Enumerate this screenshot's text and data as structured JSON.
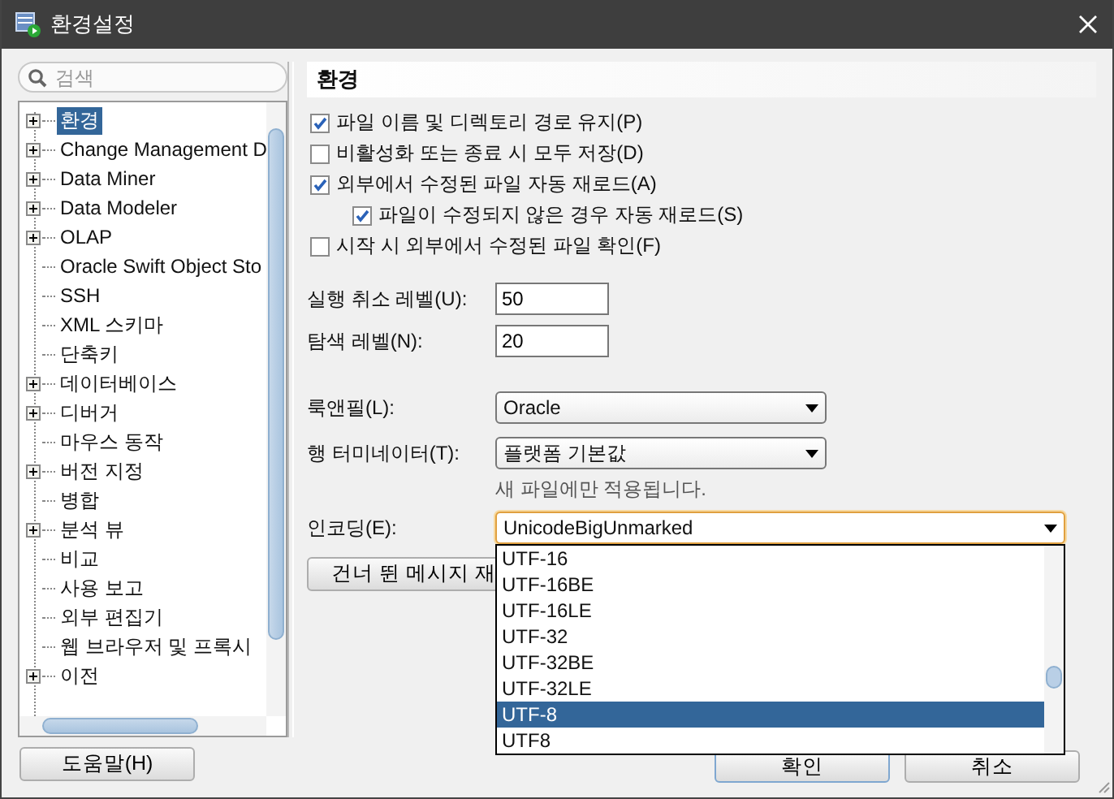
{
  "window": {
    "title": "환경설정"
  },
  "search": {
    "placeholder": "검색"
  },
  "tree": {
    "items": [
      {
        "label": "환경",
        "has_children": true,
        "selected": true
      },
      {
        "label": "Change Management D",
        "has_children": true,
        "selected": false
      },
      {
        "label": "Data Miner",
        "has_children": true,
        "selected": false
      },
      {
        "label": "Data Modeler",
        "has_children": true,
        "selected": false
      },
      {
        "label": "OLAP",
        "has_children": true,
        "selected": false
      },
      {
        "label": "Oracle Swift Object Sto",
        "has_children": false,
        "selected": false
      },
      {
        "label": "SSH",
        "has_children": false,
        "selected": false
      },
      {
        "label": "XML 스키마",
        "has_children": false,
        "selected": false
      },
      {
        "label": "단축키",
        "has_children": false,
        "selected": false
      },
      {
        "label": "데이터베이스",
        "has_children": true,
        "selected": false
      },
      {
        "label": "디버거",
        "has_children": true,
        "selected": false
      },
      {
        "label": "마우스 동작",
        "has_children": false,
        "selected": false
      },
      {
        "label": "버전 지정",
        "has_children": true,
        "selected": false
      },
      {
        "label": "병합",
        "has_children": false,
        "selected": false
      },
      {
        "label": "분석 뷰",
        "has_children": true,
        "selected": false
      },
      {
        "label": "비교",
        "has_children": false,
        "selected": false
      },
      {
        "label": "사용 보고",
        "has_children": false,
        "selected": false
      },
      {
        "label": "외부 편집기",
        "has_children": false,
        "selected": false
      },
      {
        "label": "웹 브라우저 및 프록시",
        "has_children": false,
        "selected": false
      },
      {
        "label": "이전",
        "has_children": true,
        "selected": false
      }
    ]
  },
  "panel": {
    "title": "환경",
    "checkboxes": [
      {
        "label": "파일 이름 및 디렉토리 경로 유지(P)",
        "checked": true
      },
      {
        "label": "비활성화 또는 종료 시 모두 저장(D)",
        "checked": false
      },
      {
        "label": "외부에서 수정된 파일 자동 재로드(A)",
        "checked": true,
        "children": [
          {
            "label": "파일이 수정되지 않은 경우 자동 재로드(S)",
            "checked": true
          }
        ]
      },
      {
        "label": "시작 시 외부에서 수정된 파일 확인(F)",
        "checked": false
      }
    ],
    "fields": [
      {
        "label": "실행 취소 레벨(U):",
        "value": "50"
      },
      {
        "label": "탐색 레벨(N):",
        "value": "20"
      }
    ],
    "combos": [
      {
        "label": "룩앤필(L):",
        "value": "Oracle",
        "focused": false
      },
      {
        "label": "행 터미네이터(T):",
        "value": "플랫폼 기본값",
        "focused": false,
        "note": "새 파일에만 적용됩니다."
      },
      {
        "label": "인코딩(E):",
        "value": "UnicodeBigUnmarked",
        "focused": true
      }
    ],
    "skipped_messages_button": "건너 뛴 메시지 재"
  },
  "dropdown": {
    "options": [
      {
        "label": "UTF-16",
        "selected": false
      },
      {
        "label": "UTF-16BE",
        "selected": false
      },
      {
        "label": "UTF-16LE",
        "selected": false
      },
      {
        "label": "UTF-32",
        "selected": false
      },
      {
        "label": "UTF-32BE",
        "selected": false
      },
      {
        "label": "UTF-32LE",
        "selected": false
      },
      {
        "label": "UTF-8",
        "selected": true
      },
      {
        "label": "UTF8",
        "selected": false
      }
    ]
  },
  "buttons": {
    "help": "도움말(H)",
    "ok": "확인",
    "cancel": "취소"
  }
}
